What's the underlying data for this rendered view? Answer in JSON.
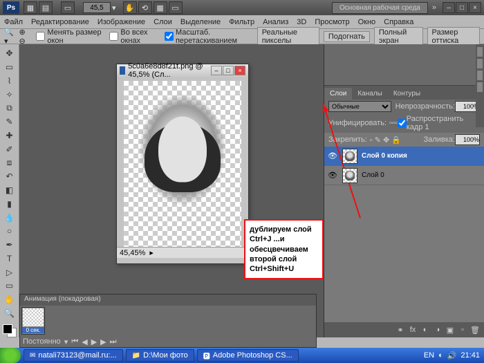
{
  "titlebar": {
    "logo": "Ps",
    "zoom": "45,5",
    "workspace": "Основная рабочая среда"
  },
  "menu": [
    "Файл",
    "Редактирование",
    "Изображение",
    "Слои",
    "Выделение",
    "Фильтр",
    "Анализ",
    "3D",
    "Просмотр",
    "Окно",
    "Справка"
  ],
  "optbar": {
    "opt1": "Менять размер окон",
    "opt2": "Во всех окнах",
    "opt3": "Масштаб. перетаскиванием",
    "btn1": "Реальные пикселы",
    "btn2": "Подогнать",
    "btn3": "Полный экран",
    "btn4": "Размер оттиска"
  },
  "doc": {
    "title": "5c0a6e8d8f21t.png @ 45,5% (Сл...",
    "status": "45,45%"
  },
  "annotation": {
    "l1": "дублируем слой",
    "l2": "Ctrl+J ...и",
    "l3": "обесцвечиваем",
    "l4": "второй слой",
    "l5": "Ctrl+Shift+U"
  },
  "panels": {
    "tabs": [
      "Слои",
      "Каналы",
      "Контуры"
    ],
    "blend": "Обычные",
    "opacity_lbl": "Непрозрачность:",
    "opacity": "100%",
    "unify": "Унифицировать:",
    "propagate": "Распространить кадр 1",
    "lock": "Закрепить:",
    "fill_lbl": "Заливка:",
    "fill": "100%",
    "layer1": "Слой 0 копия",
    "layer2": "Слой 0"
  },
  "anim": {
    "title": "Анимация (покадровая)",
    "time": "0 сек.",
    "loop": "Постоянно"
  },
  "taskbar": {
    "t1": "natali73123@mail.ru:...",
    "t2": "D:\\Мои фото",
    "t3": "Adobe Photoshop CS...",
    "lang": "EN",
    "time": "21:41"
  }
}
